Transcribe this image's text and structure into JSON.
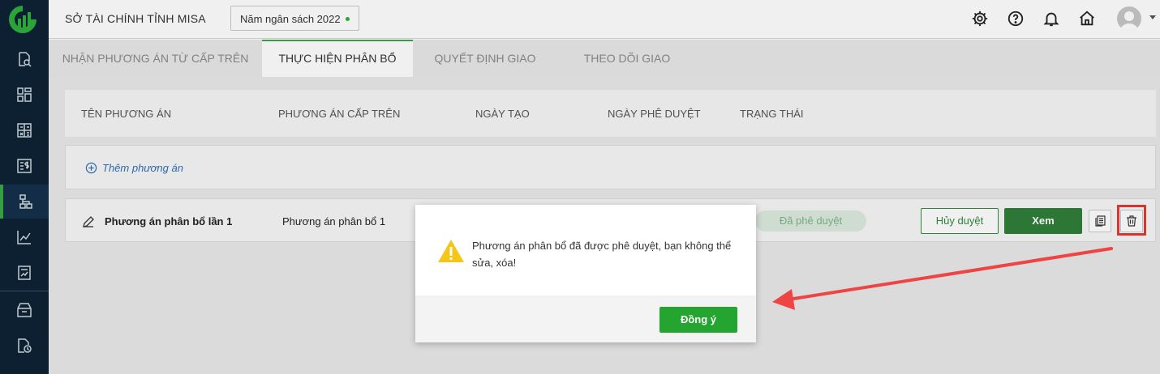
{
  "header": {
    "org_name": "SỞ TÀI CHÍNH TỈNH MISA",
    "budget_year": "Năm ngân sách 2022",
    "icons": [
      "gear-icon",
      "help-icon",
      "bell-icon",
      "home-icon",
      "avatar"
    ]
  },
  "sidebar": {
    "icons": [
      "search-doc-icon",
      "dashboard-icon",
      "calculator-icon",
      "budget-icon",
      "hierarchy-icon",
      "chart-icon",
      "report-icon",
      "archive-icon",
      "history-icon"
    ],
    "active": "hierarchy-icon"
  },
  "tabs": [
    {
      "label": "NHẬN PHƯƠNG ÁN TỪ CẤP TRÊN",
      "active": false
    },
    {
      "label": "THỰC HIỆN PHÂN BỔ",
      "active": true
    },
    {
      "label": "QUYẾT ĐỊNH GIAO",
      "active": false
    },
    {
      "label": "THEO DÕI GIAO",
      "active": false
    }
  ],
  "table": {
    "columns": [
      "TÊN PHƯƠNG ÁN",
      "PHƯƠNG ÁN CẤP TRÊN",
      "NGÀY TẠO",
      "NGÀY PHÊ DUYỆT",
      "TRẠNG THÁI"
    ],
    "add_label": "Thêm phương án",
    "rows": [
      {
        "name": "Phương án phân bổ lần 1",
        "parent": "Phương án phân bổ 1",
        "status": "Đã phê duyệt",
        "unapprove_label": "Hủy duyệt",
        "view_label": "Xem"
      }
    ]
  },
  "dialog": {
    "message": "Phương án phân bổ đã được phê duyệt, bạn không thể sửa, xóa!",
    "ok_label": "Đồng ý"
  },
  "colors": {
    "sidebar_bg": "#0e2235",
    "accent": "#3aa845",
    "primary_button": "#2f7f3a",
    "ok_button": "#24a52f",
    "highlight": "#e53935"
  }
}
